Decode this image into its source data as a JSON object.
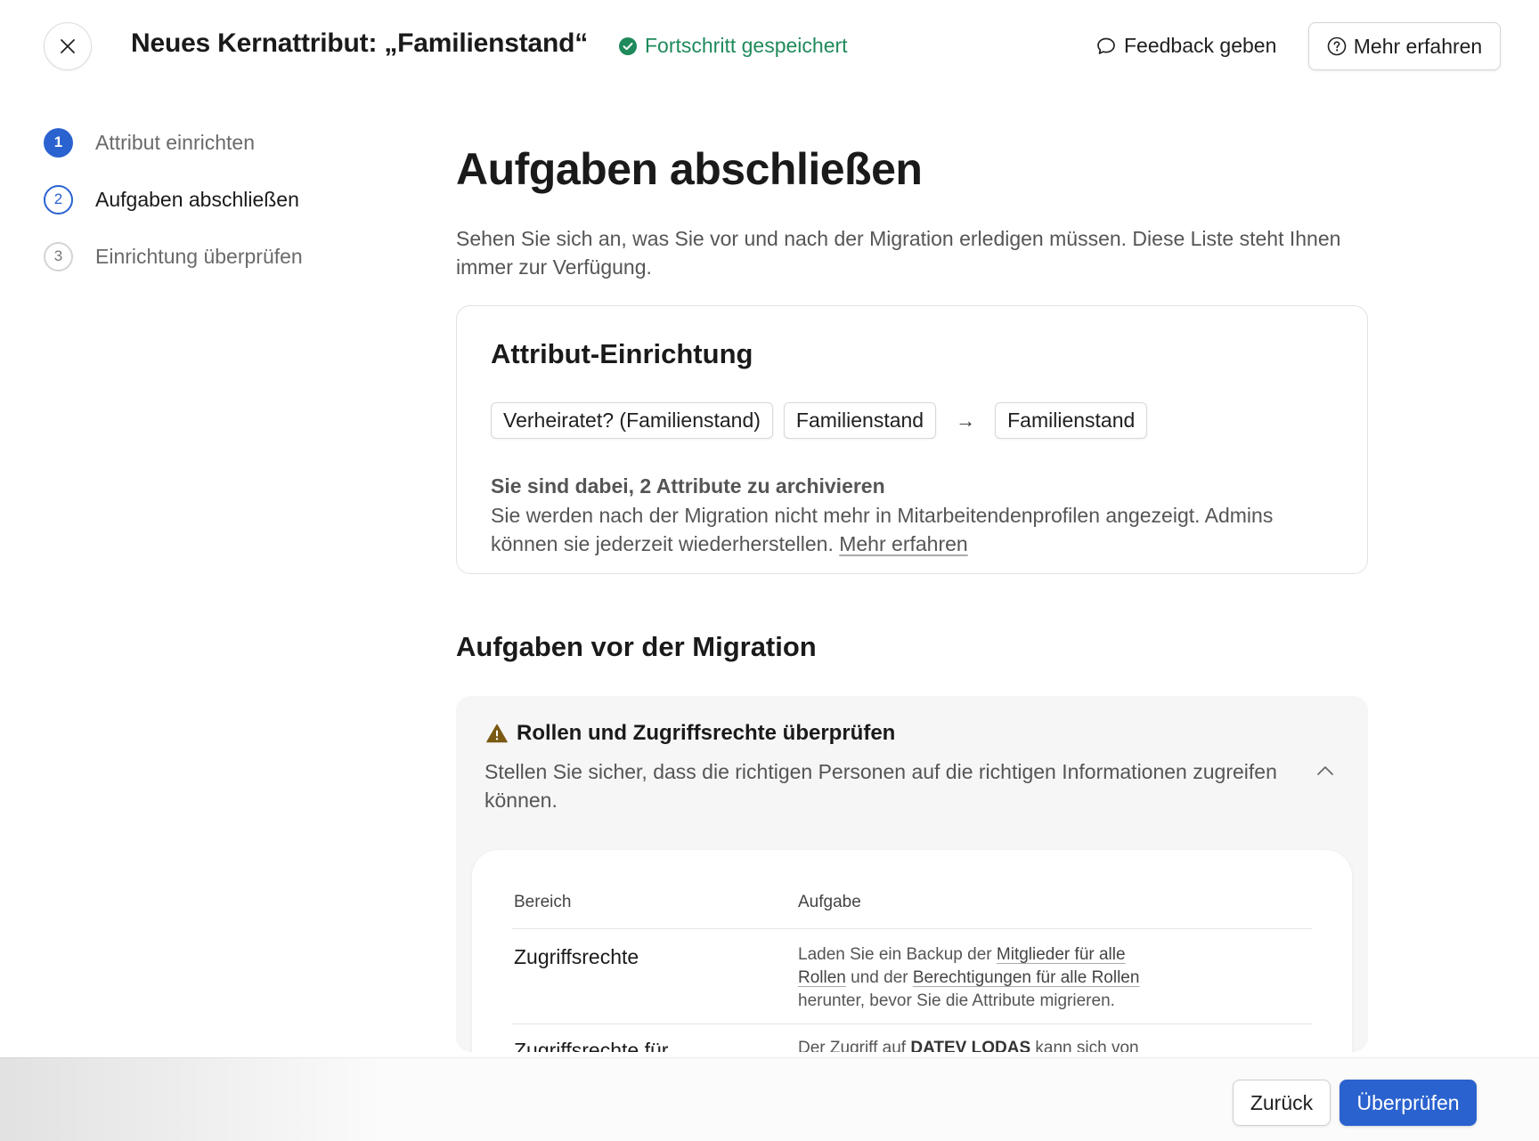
{
  "header": {
    "title": "Neues Kernattribut: „Familienstand“",
    "saved_status": "Fortschritt gespeichert",
    "feedback_label": "Feedback geben",
    "learn_more_label": "Mehr erfahren"
  },
  "stepper": {
    "steps": [
      {
        "number": "1",
        "label": "Attribut einrichten",
        "state": "done"
      },
      {
        "number": "2",
        "label": "Aufgaben abschließen",
        "state": "active"
      },
      {
        "number": "3",
        "label": "Einrichtung überprüfen",
        "state": "todo"
      }
    ]
  },
  "main": {
    "title": "Aufgaben abschließen",
    "description": "Sehen Sie sich an, was Sie vor und nach der Migration erledigen müssen. Diese Liste steht Ihnen immer zur Verfügung."
  },
  "setup_card": {
    "title": "Attribut-Einrichtung",
    "chips": [
      "Verheiratet? (Familienstand)",
      "Familienstand",
      "Familienstand"
    ],
    "arrow": "→",
    "archive_title": "Sie sind dabei, 2 Attribute zu archivieren",
    "archive_text": "Sie werden nach der Migration nicht mehr in Mitarbeitendenprofilen angezeigt. Admins können sie jederzeit wiederherstellen.",
    "archive_link": "Mehr erfahren"
  },
  "pre_migration": {
    "section_title": "Aufgaben vor der Migration",
    "task": {
      "title": "Rollen und Zugriffsrechte überprüfen",
      "description": "Stellen Sie sicher, dass die richtigen Personen auf die richtigen Informationen zugreifen können.",
      "table": {
        "headers": {
          "area": "Bereich",
          "task": "Aufgabe"
        },
        "rows": [
          {
            "area": "Zugriffsrechte",
            "task_parts": {
              "t1": "Laden Sie ein Backup der ",
              "l1": "Mitglieder für alle Rollen",
              "t2": " und der ",
              "l2": "Berechtigungen für alle Rollen",
              "t3": " herunter, bevor Sie die Attribute migrieren."
            }
          },
          {
            "area": "Zugriffsrechte für",
            "task_parts": {
              "t1": "Der Zugriff auf ",
              "b1": "DATEV LODAS",
              "t2": " kann sich von"
            }
          }
        ]
      }
    }
  },
  "footer": {
    "back_label": "Zurück",
    "review_label": "Überprüfen"
  },
  "colors": {
    "accent": "#2a62cf",
    "success": "#1f8a5b",
    "warning": "#7a5a12"
  }
}
